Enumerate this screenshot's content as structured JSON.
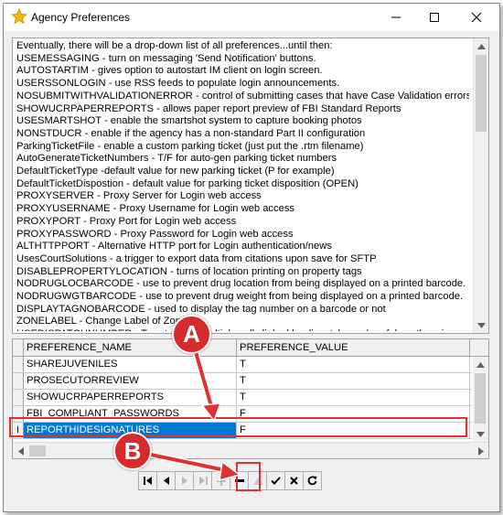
{
  "window": {
    "title": "Agency Preferences",
    "icon": "star-icon",
    "controls": [
      "minimize-icon",
      "maximize-icon",
      "close-icon"
    ]
  },
  "notes": {
    "lines": [
      "Eventually, there will be a drop-down list of all preferences...until then:",
      "USEMESSAGING - turn on messaging 'Send Notification' buttons.",
      "AUTOSTARTIM - gives option to autostart IM client on login screen.",
      "USERSSONLOGIN - use RSS feeds to populate login announcements.",
      "NOSUBMITWITHVALIDATIONERROR - control of submitting cases that have Case Validation errors",
      "SHOWUCRPAPERREPORTS - allows paper report preview of FBI Standard Reports",
      "USESMARTSHOT - enable the smartshot system to capture booking photos",
      "NONSTDUCR - enable if the agency has a non-standard Part II configuration",
      "ParkingTicketFile - enable a custom parking ticket (just put the .rtm filename)",
      "AutoGenerateTicketNumbers - T/F for auto-gen parking ticket numbers",
      "DefaultTicketType -default value for new parking ticket (P for example)",
      "DefaultTicketDispostion - default value for parking ticket disposition (OPEN)",
      "PROXYSERVER - Proxy Server for Login web access",
      "PROXYUSERNAME - Proxy Username for Login web access",
      "PROXYPORT - Proxy Port for Login web access",
      "PROXYPASSWORD - Proxy Password for Login web access",
      "ALTHTTPPORT - Alternative HTTP port for Login authentication/news",
      "UsesCourtSolutions - a trigger to export data from citations upon save for SFTP",
      "DISABLEPROPERTYLOCATION - turns of location printing on property tags",
      "NODRUGLOCBARCODE - use to prevent drug location from being displayed on a printed barcode.",
      "NODRUGWGTBARCODE - use to prevent drug weight from being displayed on a printed barcode.",
      "DISPLAYTAGNOBARCODE - used to display the tag number on a barcode or not",
      "ZONELABEL - Change Label of Zone",
      "USEDISPATCHNUMBER - True to have multiple calls linked by dispatch number, false otherwise"
    ]
  },
  "grid": {
    "columns": [
      "PREFERENCE_NAME",
      "PREFERENCE_VALUE"
    ],
    "rows": [
      {
        "name": "SHAREJUVENILES",
        "value": "T",
        "indicator": ""
      },
      {
        "name": "PROSECUTORREVIEW",
        "value": "T",
        "indicator": ""
      },
      {
        "name": "SHOWUCRPAPERREPORTS",
        "value": "T",
        "indicator": ""
      },
      {
        "name": "FBI_COMPLIANT_PASSWORDS",
        "value": "F",
        "indicator": ""
      },
      {
        "name": "REPORTHIDESIGNATURES",
        "value": "F",
        "indicator": "I",
        "selected": true
      }
    ]
  },
  "navigator": {
    "buttons": [
      {
        "name": "first-record-button",
        "icon": "first-icon",
        "enabled": true
      },
      {
        "name": "prior-record-button",
        "icon": "prior-icon",
        "enabled": true
      },
      {
        "name": "next-record-button",
        "icon": "next-icon",
        "enabled": false
      },
      {
        "name": "last-record-button",
        "icon": "last-icon",
        "enabled": false
      },
      {
        "name": "insert-record-button",
        "icon": "plus-icon",
        "enabled": false
      },
      {
        "name": "delete-record-button",
        "icon": "minus-icon",
        "enabled": true
      },
      {
        "name": "edit-record-button",
        "icon": "triangle-up-icon",
        "enabled": false
      },
      {
        "name": "post-edit-button",
        "icon": "checkmark-icon",
        "enabled": true
      },
      {
        "name": "cancel-edit-button",
        "icon": "x-icon",
        "enabled": true
      },
      {
        "name": "refresh-button",
        "icon": "refresh-icon",
        "enabled": true
      }
    ]
  },
  "annotations": {
    "a_label": "A",
    "b_label": "B",
    "color": "#d62b2b",
    "selection_color": "#0078d7"
  }
}
